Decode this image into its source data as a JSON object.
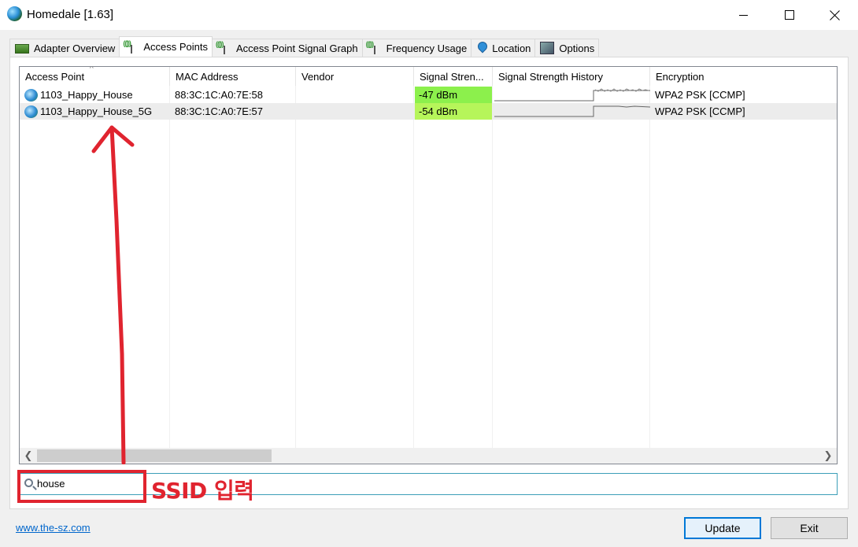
{
  "window": {
    "title": "Homedale [1.63]"
  },
  "tabs": [
    {
      "label": "Adapter Overview",
      "icon": "adapter-icon"
    },
    {
      "label": "Access Points",
      "icon": "antenna-icon",
      "active": true
    },
    {
      "label": "Access Point Signal Graph",
      "icon": "antenna-icon"
    },
    {
      "label": "Frequency Usage",
      "icon": "antenna-icon"
    },
    {
      "label": "Location",
      "icon": "location-pin-icon"
    },
    {
      "label": "Options",
      "icon": "options-icon"
    }
  ],
  "list": {
    "columns": [
      "Access Point",
      "MAC Address",
      "Vendor",
      "Signal Stren...",
      "Signal Strength History",
      "Encryption"
    ],
    "sort_indicator": "^",
    "rows": [
      {
        "access_point": "1103_Happy_House",
        "mac": "88:3C:1C:A0:7E:58",
        "vendor": "",
        "signal": "-47 dBm",
        "signal_color": "#8cf04c",
        "encryption": "WPA2 PSK [CCMP]"
      },
      {
        "access_point": "1103_Happy_House_5G",
        "mac": "88:3C:1C:A0:7E:57",
        "vendor": "",
        "signal": "-54 dBm",
        "signal_color": "#b6f55a",
        "encryption": "WPA2 PSK [CCMP]"
      }
    ]
  },
  "filter": {
    "value": "house"
  },
  "annotation": {
    "label": "SSID 입력",
    "color": "#e0242f"
  },
  "footer": {
    "link_text": "www.the-sz.com",
    "update_label": "Update",
    "exit_label": "Exit"
  }
}
